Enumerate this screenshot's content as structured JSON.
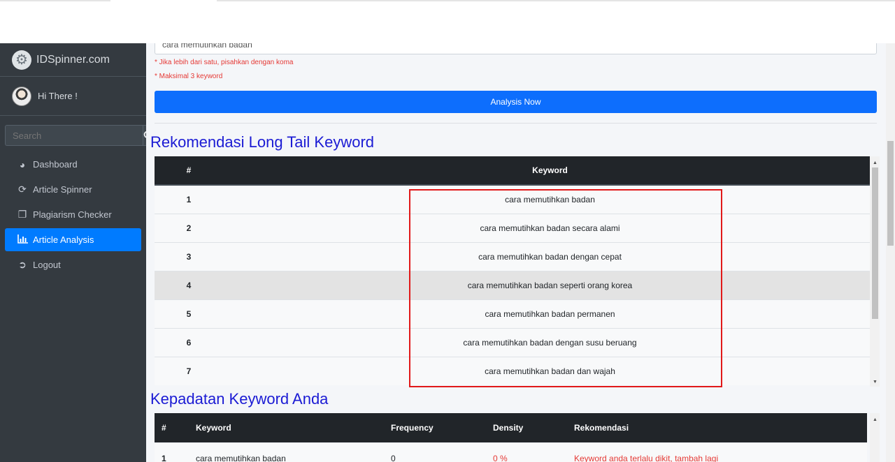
{
  "brand": {
    "name": "IDSpinner.com",
    "logo_icon": "gear-icon"
  },
  "user": {
    "greeting": "Hi There !"
  },
  "search": {
    "placeholder": "Search"
  },
  "nav": [
    {
      "label": "Dashboard",
      "icon": "dashboard-icon",
      "active": false
    },
    {
      "label": "Article Spinner",
      "icon": "sync-icon",
      "active": false
    },
    {
      "label": "Plagiarism Checker",
      "icon": "copy-icon",
      "active": false
    },
    {
      "label": "Article Analysis",
      "icon": "chart-icon",
      "active": true
    },
    {
      "label": "Logout",
      "icon": "logout-icon",
      "active": false
    }
  ],
  "form": {
    "keyword_value": "cara memutihkan badan",
    "note1": "* Jika lebih dari satu, pisahkan dengan koma",
    "note2": "* Maksimal 3 keyword",
    "button": "Analysis Now"
  },
  "longtail": {
    "title": "Rekomendasi Long Tail Keyword",
    "headers": {
      "num": "#",
      "keyword": "Keyword"
    },
    "rows": [
      {
        "num": "1",
        "keyword": "cara memutihkan badan"
      },
      {
        "num": "2",
        "keyword": "cara memutihkan badan secara alami"
      },
      {
        "num": "3",
        "keyword": "cara memutihkan badan dengan cepat"
      },
      {
        "num": "4",
        "keyword": "cara memutihkan badan seperti orang korea"
      },
      {
        "num": "5",
        "keyword": "cara memutihkan badan permanen"
      },
      {
        "num": "6",
        "keyword": "cara memutihkan badan dengan susu beruang"
      },
      {
        "num": "7",
        "keyword": "cara memutihkan badan dan wajah"
      }
    ]
  },
  "density": {
    "title": "Kepadatan Keyword Anda",
    "headers": {
      "num": "#",
      "keyword": "Keyword",
      "frequency": "Frequency",
      "density": "Density",
      "rekomendasi": "Rekomendasi"
    },
    "rows": [
      {
        "num": "1",
        "keyword": "cara memutihkan badan",
        "frequency": "0",
        "density": "0 %",
        "rekomendasi": "Keyword anda terlalu dikit, tambah lagi"
      }
    ]
  },
  "colors": {
    "primary": "#007bff",
    "sidebar": "#343a40",
    "title": "#1b1bd4",
    "warning": "#e53935",
    "highlight_box": "#e11919"
  }
}
